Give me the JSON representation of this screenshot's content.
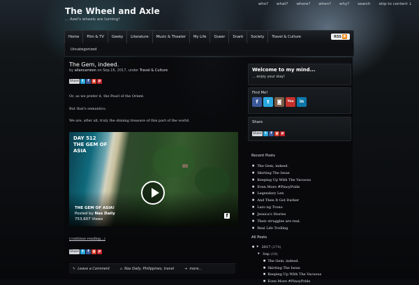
{
  "site": {
    "title": "The Wheel and Axle",
    "tagline": "... Axel's wheels are turning!"
  },
  "top_nav": [
    "who?",
    "what?",
    "where?",
    "when?",
    "why?",
    "search",
    "skip to content ↓"
  ],
  "main_nav": [
    "Home",
    "Film & TV",
    "Geeky",
    "Literature",
    "Music & Theater",
    "My Life",
    "Queer",
    "Snark",
    "Society",
    "Travel & Culture"
  ],
  "rss_label": "RSS",
  "breadcrumb": "Uncategorized",
  "post": {
    "title": "The Gem, indeed.",
    "meta_by": "by",
    "author": "allancarreon",
    "meta_on": "on Sep.16, 2017, under",
    "category": "Travel & Culture",
    "share_label": "Share",
    "paragraphs": [
      "Or, as we prefer it, the Pearl of the Orient.",
      "But that's semantics.",
      "We are, after all, truly the shining treasure of this part of the world."
    ],
    "video": {
      "headline_day": "DAY 512",
      "headline_1": "THE GEM OF",
      "headline_2": "ASIA",
      "title": "THE GEM OF ASIA!",
      "posted_by_label": "Posted by",
      "posted_by": "Nas Daily",
      "views": "753,607 Views"
    },
    "continue": "(continue reading...)",
    "footer": {
      "comment": "Leave a Comment",
      "tags": "Nas Daily, Philippines, travel",
      "more": "more..."
    }
  },
  "sidebar": {
    "welcome_title": "Welcome to my mind...",
    "welcome_sub": "... enjoy your stay!",
    "find_me": "Find Me!",
    "social_icons": [
      "facebook-icon",
      "twitter-icon",
      "instagram-icon",
      "youtube-icon",
      "linkedin-icon"
    ],
    "share_title": "Share",
    "share_label": "Share",
    "recent_title": "Recent Posts",
    "recent_posts": [
      "The Gem, indeed.",
      "Skirting The Issue",
      "Keeping Up With The Vacuous",
      "Even More #PinoyPride",
      "Legendary Len",
      "And Then It Got Darker",
      "Laro ng Trono",
      "Jessica's Stories",
      "Their struggles are real.",
      "Real Life Trolling"
    ],
    "archive_title": "All Posts",
    "archive": {
      "year": "2017",
      "year_count": "(274)",
      "month": "Sep",
      "month_count": "(16)",
      "posts": [
        "The Gem, indeed.",
        "Skirting The Issue",
        "Keeping Up With The Vacuous",
        "Even More #PinoyPride"
      ]
    }
  },
  "colors": {
    "facebook": "#3b5998",
    "twitter": "#2aa9e0",
    "googleplus": "#d8402e",
    "pinterest": "#c8232c",
    "rss": "#f08a1c"
  }
}
